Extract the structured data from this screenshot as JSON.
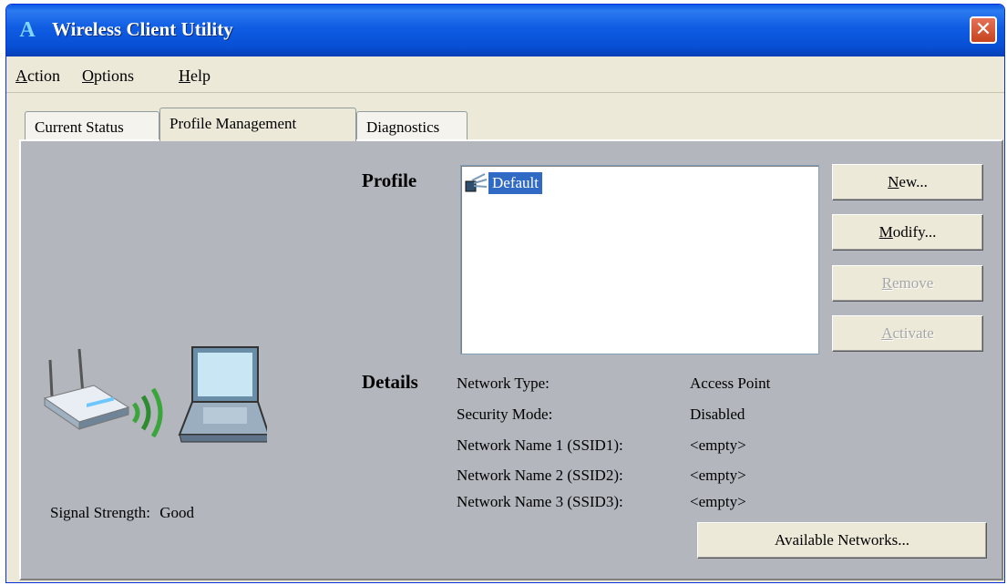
{
  "window": {
    "title": "Wireless Client Utility",
    "app_icon_glyph": "A",
    "close_glyph": "✕"
  },
  "menu": {
    "items": [
      {
        "label_ul": "A",
        "label_rest": "ction"
      },
      {
        "label_ul": "O",
        "label_rest": "ptions"
      },
      {
        "label_ul": "H",
        "label_rest": "elp"
      }
    ]
  },
  "tabs": [
    {
      "label": "Current Status",
      "active": false
    },
    {
      "label": "Profile Management",
      "active": true
    },
    {
      "label": "Diagnostics",
      "active": false
    }
  ],
  "profile": {
    "section_label": "Profile",
    "items": [
      {
        "name": "Default",
        "selected": true
      }
    ]
  },
  "buttons": {
    "new": {
      "ul": "N",
      "rest": "ew...",
      "enabled": true
    },
    "modify": {
      "ul": "M",
      "rest": "odify...",
      "enabled": true
    },
    "remove": {
      "ul": "R",
      "rest": "emove",
      "enabled": false
    },
    "activate": {
      "ul": "A",
      "rest": "ctivate",
      "enabled": false
    },
    "available_networks": "Available Networks..."
  },
  "details": {
    "section_label": "Details",
    "rows": [
      {
        "label": "Network Type:",
        "value": "Access Point"
      },
      {
        "label": "Security Mode:",
        "value": "Disabled"
      },
      {
        "label": "Network Name 1 (SSID1):",
        "value": "<empty>"
      },
      {
        "label": "Network Name 2 (SSID2):",
        "value": "<empty>"
      },
      {
        "label": "Network Name 3 (SSID3):",
        "value": "<empty>"
      }
    ]
  },
  "signal": {
    "label": "Signal Strength:",
    "value": "Good"
  },
  "colors": {
    "title_bar": "#0a5ae6",
    "panel_bg": "#b3b6bd",
    "selection": "#316ac5",
    "signal_waves": "#3aa53a"
  }
}
